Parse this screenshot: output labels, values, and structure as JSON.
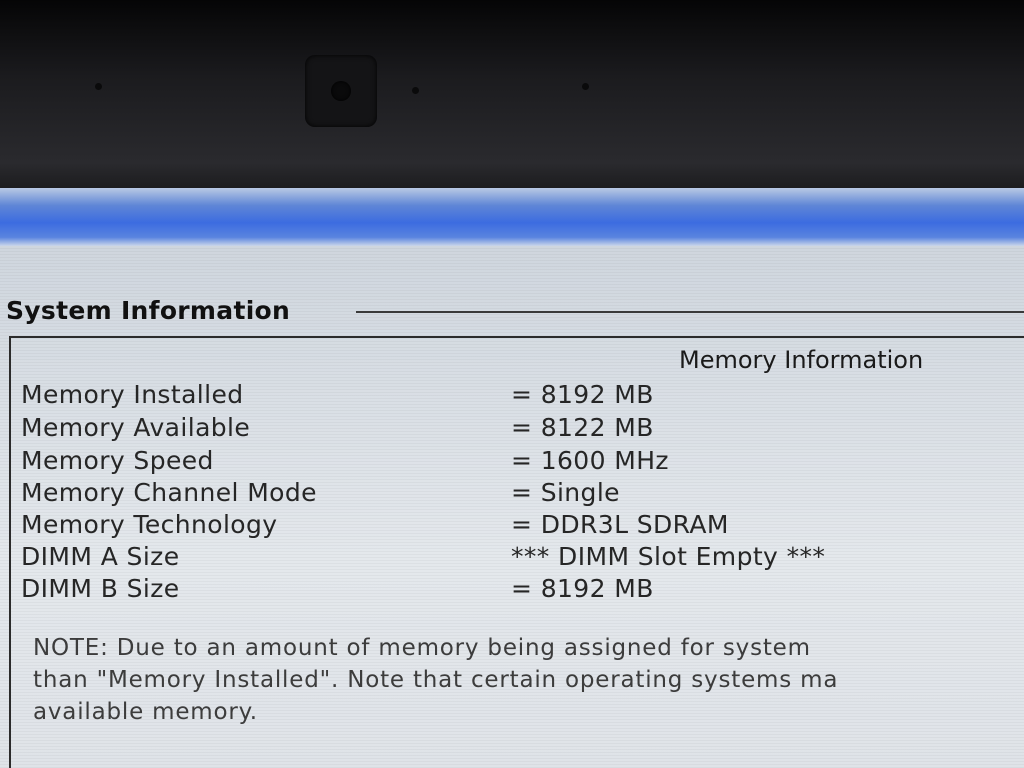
{
  "section": {
    "title": "System Information"
  },
  "panel": {
    "heading": "Memory Information",
    "rows": [
      {
        "label": "Memory Installed",
        "value": "= 8192 MB"
      },
      {
        "label": "Memory Available",
        "value": "= 8122 MB"
      },
      {
        "label": "Memory Speed",
        "value": "= 1600 MHz"
      },
      {
        "label": "Memory Channel Mode",
        "value": "= Single"
      },
      {
        "label": "Memory Technology",
        "value": "= DDR3L SDRAM"
      },
      {
        "label": "DIMM A Size",
        "value": "*** DIMM Slot Empty ***"
      },
      {
        "label": "DIMM B Size",
        "value": "= 8192 MB"
      }
    ],
    "note": {
      "line1": "NOTE: Due to an amount of memory being assigned for system",
      "line2": "than \"Memory Installed\". Note that certain operating systems ma",
      "line3": "available memory."
    }
  },
  "colors": {
    "title_bar": "#3c6ce0",
    "background": "#dde2e8",
    "text": "#262626"
  }
}
